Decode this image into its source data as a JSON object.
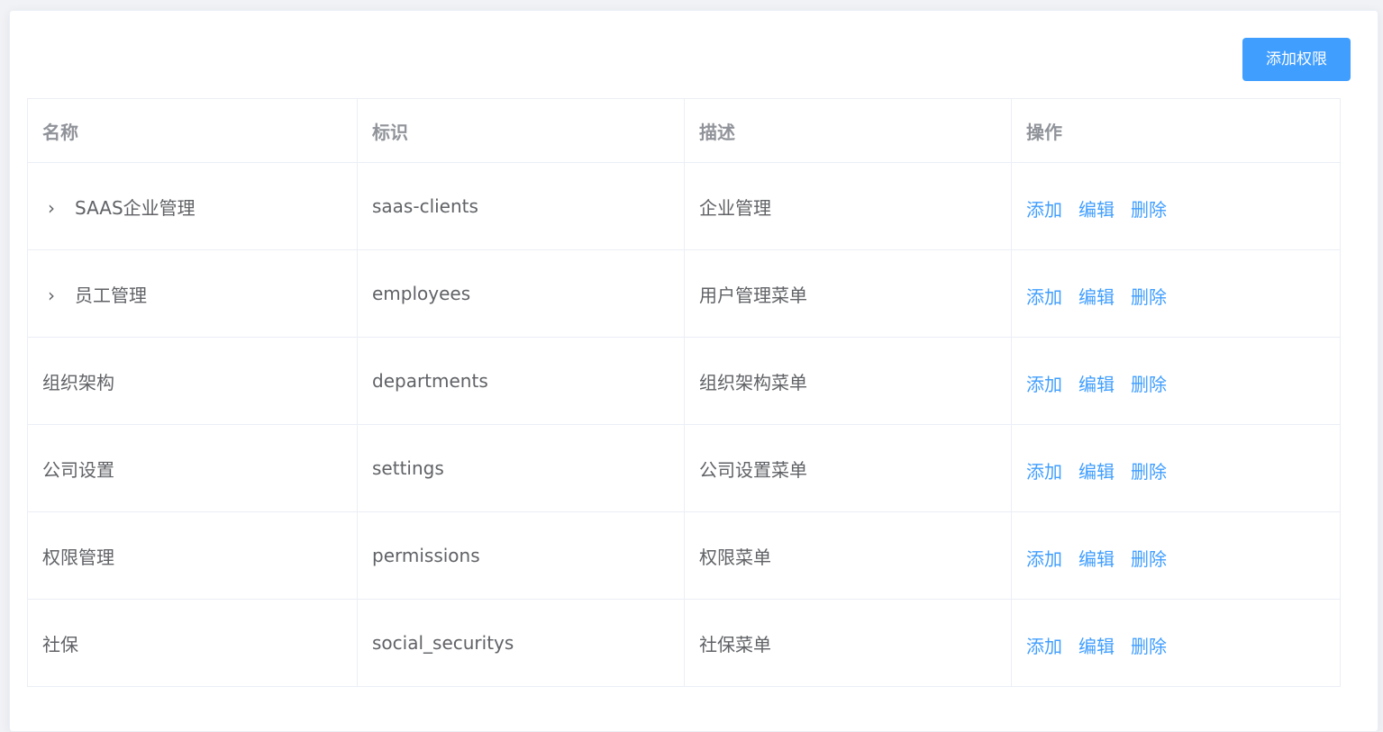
{
  "toolbar": {
    "add_permission_label": "添加权限"
  },
  "table": {
    "headers": [
      "名称",
      "标识",
      "描述",
      "操作"
    ],
    "rows": [
      {
        "name": "SAAS企业管理",
        "ident": "saas-clients",
        "desc": "企业管理",
        "expandable": true
      },
      {
        "name": "员工管理",
        "ident": "employees",
        "desc": "用户管理菜单",
        "expandable": true
      },
      {
        "name": "组织架构",
        "ident": "departments",
        "desc": "组织架构菜单",
        "expandable": false
      },
      {
        "name": "公司设置",
        "ident": "settings",
        "desc": "公司设置菜单",
        "expandable": false
      },
      {
        "name": "权限管理",
        "ident": "permissions",
        "desc": "权限菜单",
        "expandable": false
      },
      {
        "name": "社保",
        "ident": "social_securitys",
        "desc": "社保菜单",
        "expandable": false
      }
    ],
    "actions": {
      "add": "添加",
      "edit": "编辑",
      "delete": "删除"
    }
  },
  "icons": {
    "expand": "chevron-right-icon"
  },
  "colors": {
    "primary": "#409eff",
    "header_text": "#909399",
    "body_text": "#606266",
    "border": "#ebeef5"
  }
}
